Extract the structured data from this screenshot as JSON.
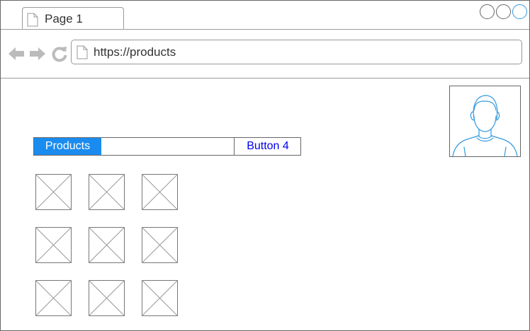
{
  "browser": {
    "tab": {
      "label": "Page 1"
    },
    "address_bar": {
      "url": "https://products"
    },
    "nav": {
      "back_icon": "arrow-left-icon",
      "forward_icon": "arrow-right-icon",
      "reload_icon": "reload-icon"
    },
    "window_controls": [
      "minimize",
      "maximize",
      "close"
    ]
  },
  "profile": {
    "icon": "user-avatar-icon",
    "accent": "#3399dd"
  },
  "menu": {
    "items": [
      {
        "label": "Products",
        "selected": true
      },
      {
        "label": ""
      },
      {
        "label": "Button 4"
      }
    ],
    "selected_color": "#1a8cf0",
    "link_color": "#0000ee"
  },
  "gallery": {
    "rows": 3,
    "columns": 3,
    "placeholder_icon": "image-placeholder-icon"
  }
}
